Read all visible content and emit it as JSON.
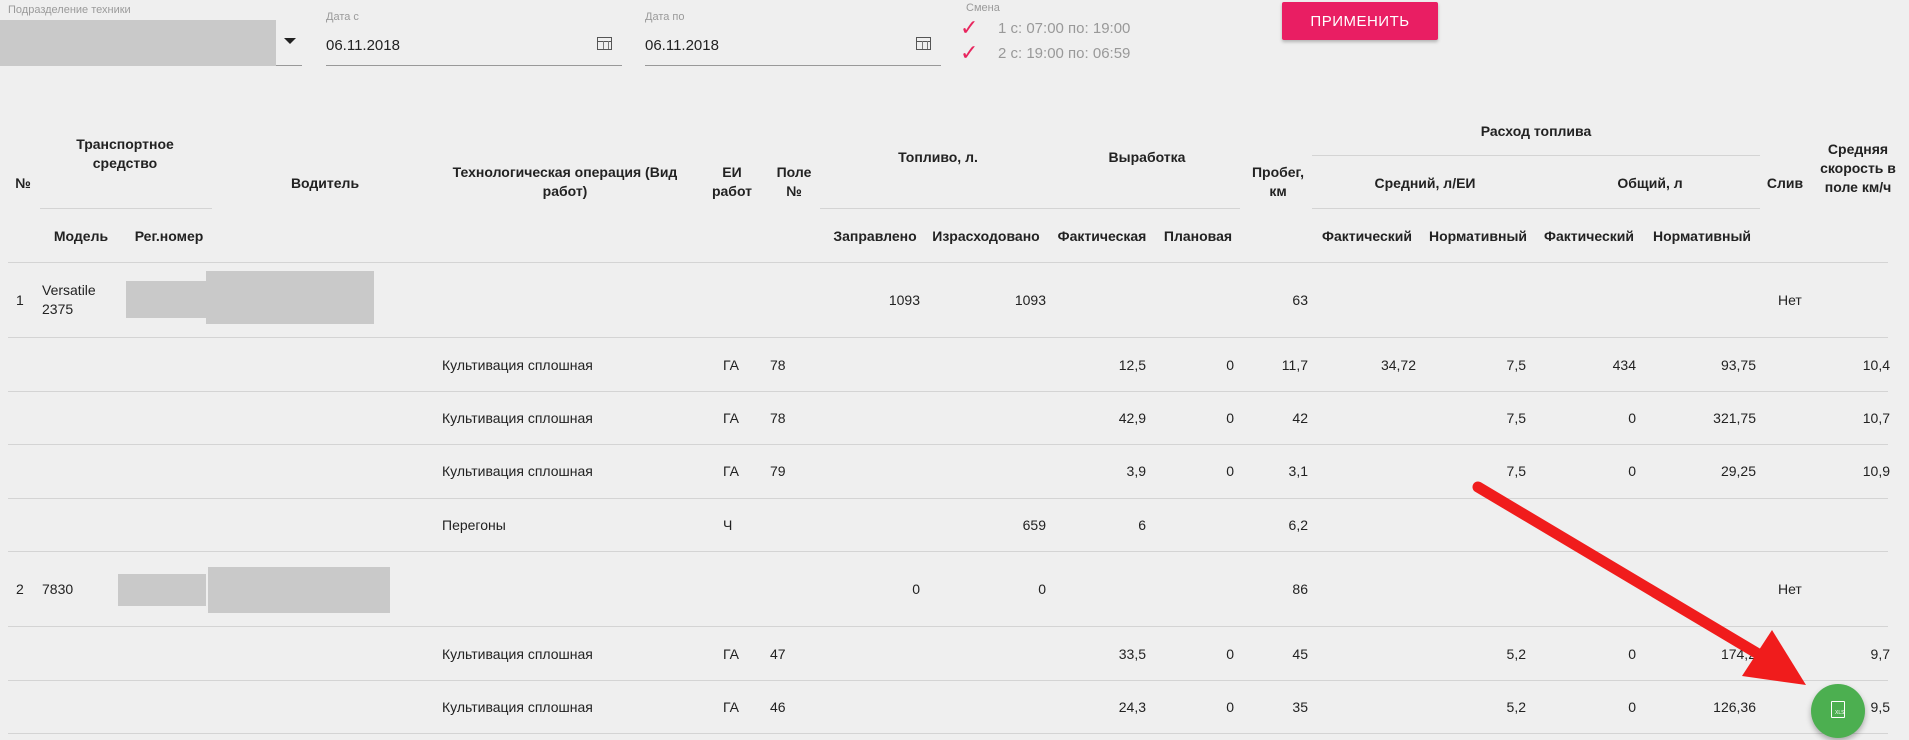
{
  "filters": {
    "division_label": "Подразделение техники",
    "date_from_label": "Дата с",
    "date_from_value": "06.11.2018",
    "date_to_label": "Дата по",
    "date_to_value": "06.11.2018",
    "shift_label": "Смена",
    "shift_1": "1 с: 07:00 по: 19:00",
    "shift_2": "2 с: 19:00 по: 06:59",
    "apply_label": "ПРИМЕНИТЬ"
  },
  "header": {
    "no": "№",
    "vehicle": "Транспортное средство",
    "model": "Модель",
    "reg": "Рег.номер",
    "driver": "Водитель",
    "operation": "Технологическая операция (Вид работ)",
    "unit": "ЕИ работ",
    "field": "Поле №",
    "fuel": "Топливо, л.",
    "fuel_filled": "Заправлено",
    "fuel_spent": "Израсходовано",
    "output": "Выработка",
    "output_fact": "Фактическая",
    "output_plan": "Плановая",
    "mileage": "Пробег, км",
    "consumption": "Расход топлива",
    "avg": "Средний, л/ЕИ",
    "total": "Общий, л",
    "fact1": "Фактический",
    "norm1": "Нормативный",
    "fact2": "Фактический",
    "norm2": "Нормативный",
    "drain": "Слив",
    "speed": "Средняя скорость в поле км/ч"
  },
  "rows": [
    {
      "no": "1",
      "model": "Versatile 2375",
      "operation": "",
      "unit": "",
      "field": "",
      "filled": "1093",
      "spent": "1093",
      "fact": "",
      "plan": "",
      "mileage": "63",
      "avg_fact": "",
      "avg_norm": "",
      "tot_fact": "",
      "tot_norm": "",
      "drain": "Нет",
      "speed": ""
    },
    {
      "no": "",
      "model": "",
      "operation": "Культивация сплошная",
      "unit": "ГА",
      "field": "78",
      "filled": "",
      "spent": "",
      "fact": "12,5",
      "plan": "0",
      "mileage": "11,7",
      "avg_fact": "34,72",
      "avg_norm": "7,5",
      "tot_fact": "434",
      "tot_norm": "93,75",
      "drain": "",
      "speed": "10,4"
    },
    {
      "no": "",
      "model": "",
      "operation": "Культивация сплошная",
      "unit": "ГА",
      "field": "78",
      "filled": "",
      "spent": "",
      "fact": "42,9",
      "plan": "0",
      "mileage": "42",
      "avg_fact": "",
      "avg_norm": "7,5",
      "tot_fact": "0",
      "tot_norm": "321,75",
      "drain": "",
      "speed": "10,7"
    },
    {
      "no": "",
      "model": "",
      "operation": "Культивация сплошная",
      "unit": "ГА",
      "field": "79",
      "filled": "",
      "spent": "",
      "fact": "3,9",
      "plan": "0",
      "mileage": "3,1",
      "avg_fact": "",
      "avg_norm": "7,5",
      "tot_fact": "0",
      "tot_norm": "29,25",
      "drain": "",
      "speed": "10,9"
    },
    {
      "no": "",
      "model": "",
      "operation": "Перегоны",
      "unit": "Ч",
      "field": "",
      "filled": "",
      "spent": "659",
      "fact": "6",
      "plan": "",
      "mileage": "6,2",
      "avg_fact": "",
      "avg_norm": "",
      "tot_fact": "",
      "tot_norm": "",
      "drain": "",
      "speed": ""
    },
    {
      "no": "2",
      "model": "7830",
      "operation": "",
      "unit": "",
      "field": "",
      "filled": "0",
      "spent": "0",
      "fact": "",
      "plan": "",
      "mileage": "86",
      "avg_fact": "",
      "avg_norm": "",
      "tot_fact": "",
      "tot_norm": "",
      "drain": "Нет",
      "speed": ""
    },
    {
      "no": "",
      "model": "",
      "operation": "Культивация сплошная",
      "unit": "ГА",
      "field": "47",
      "filled": "",
      "spent": "",
      "fact": "33,5",
      "plan": "0",
      "mileage": "45",
      "avg_fact": "",
      "avg_norm": "5,2",
      "tot_fact": "0",
      "tot_norm": "174,2",
      "drain": "",
      "speed": "9,7"
    },
    {
      "no": "",
      "model": "",
      "operation": "Культивация сплошная",
      "unit": "ГА",
      "field": "46",
      "filled": "",
      "spent": "",
      "fact": "24,3",
      "plan": "0",
      "mileage": "35",
      "avg_fact": "",
      "avg_norm": "5,2",
      "tot_fact": "0",
      "tot_norm": "126,36",
      "drain": "",
      "speed": "9,5"
    }
  ],
  "colors": {
    "accent": "#e91e63",
    "check": "#e8265e",
    "fab": "#4caf50",
    "arrow": "#f01c1c"
  },
  "icons": {
    "calendar": "calendar-icon",
    "check": "check-icon",
    "caret": "chevron-down-icon",
    "export": "xls-file-icon"
  }
}
